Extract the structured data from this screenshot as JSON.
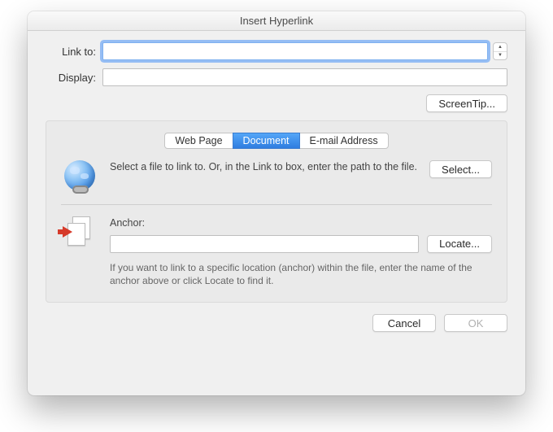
{
  "title": "Insert Hyperlink",
  "labels": {
    "link_to": "Link to:",
    "display": "Display:"
  },
  "fields": {
    "link_to_value": "",
    "display_value": "",
    "anchor_value": ""
  },
  "buttons": {
    "screentip": "ScreenTip...",
    "select": "Select...",
    "locate": "Locate...",
    "cancel": "Cancel",
    "ok": "OK"
  },
  "tabs": {
    "web": "Web Page",
    "doc": "Document",
    "email": "E-mail Address"
  },
  "doc_section": {
    "select_desc": "Select a file to link to. Or, in the Link to box, enter the path to the file.",
    "anchor_label": "Anchor:",
    "anchor_help": "If you want to link to a specific location (anchor) within the file, enter the name of the anchor above or click Locate to find it."
  }
}
